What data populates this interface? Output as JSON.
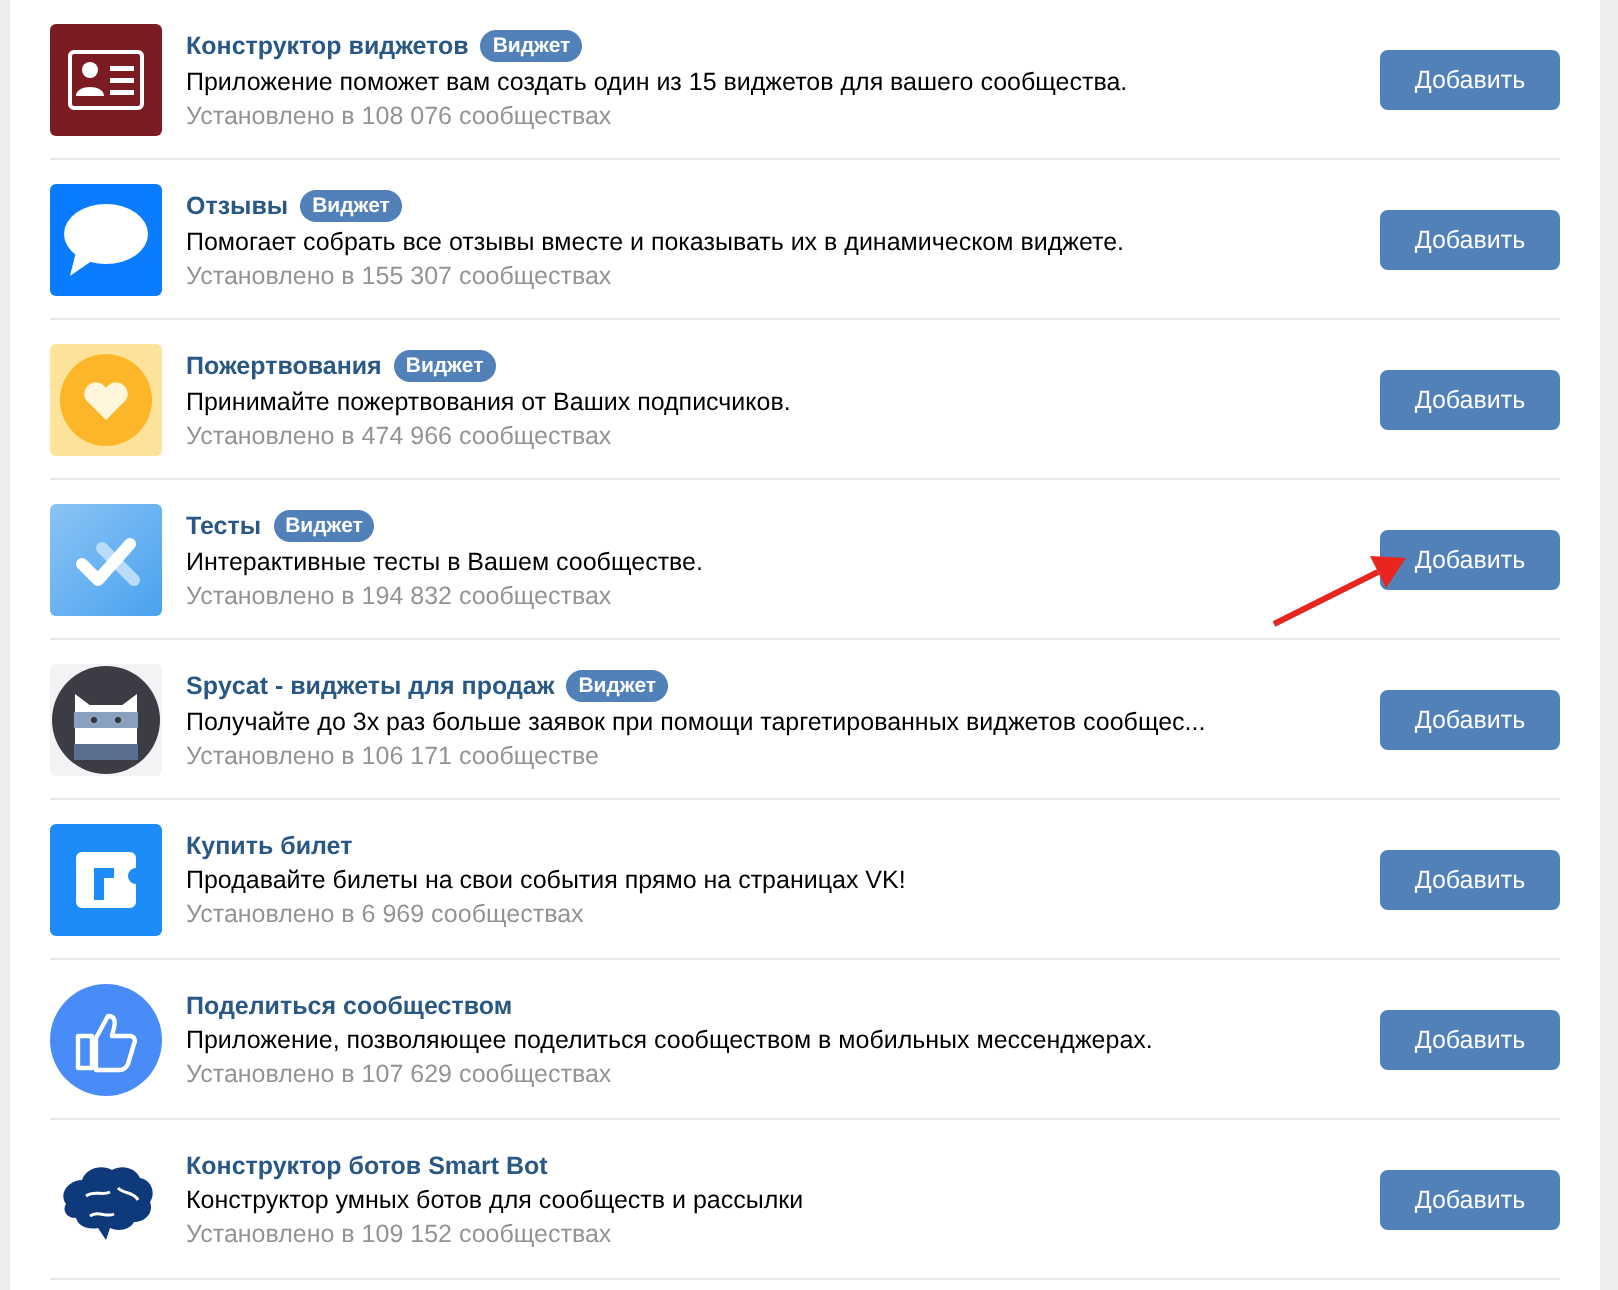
{
  "apps": [
    {
      "kind": "card",
      "title": "Конструктор виджетов",
      "badge": "Виджет",
      "description": "Приложение поможет вам создать один из 15 виджетов для вашего сообщества.",
      "installs": "Установлено в 108 076 сообществах",
      "button": "Добавить"
    },
    {
      "kind": "speech",
      "title": "Отзывы",
      "badge": "Виджет",
      "description": "Помогает собрать все отзывы вместе и показывать их в динамическом виджете.",
      "installs": "Установлено в 155 307 сообществах",
      "button": "Добавить"
    },
    {
      "kind": "heart",
      "title": "Пожертвования",
      "badge": "Виджет",
      "description": "Принимайте пожертвования от Ваших подписчиков.",
      "installs": "Установлено в 474 966 сообществах",
      "button": "Добавить"
    },
    {
      "kind": "check",
      "title": "Тесты",
      "badge": "Виджет",
      "description": "Интерактивные тесты в Вашем сообществе.",
      "installs": "Установлено в 194 832 сообществах",
      "button": "Добавить",
      "pointed": true
    },
    {
      "kind": "cat",
      "title": "Spycat - виджеты для продаж",
      "badge": "Виджет",
      "description": "Получайте до 3х раз больше заявок при помощи таргетированных виджетов сообщес...",
      "installs": "Установлено в 106 171 сообществе",
      "button": "Добавить"
    },
    {
      "kind": "ticket",
      "title": "Купить билет",
      "description": "Продавайте билеты на свои события прямо на страницах VK!",
      "installs": "Установлено в 6 969 сообществах",
      "button": "Добавить"
    },
    {
      "kind": "thumb",
      "title": "Поделиться сообществом",
      "description": "Приложение, позволяющее поделиться сообществом в мобильных мессенджерах.",
      "installs": "Установлено в 107 629 сообществах",
      "button": "Добавить"
    },
    {
      "kind": "brain",
      "title": "Конструктор ботов Smart Bot",
      "description": "Конструктор умных ботов для сообществ и рассылки",
      "installs": "Установлено в 109 152 сообществах",
      "button": "Добавить"
    }
  ]
}
